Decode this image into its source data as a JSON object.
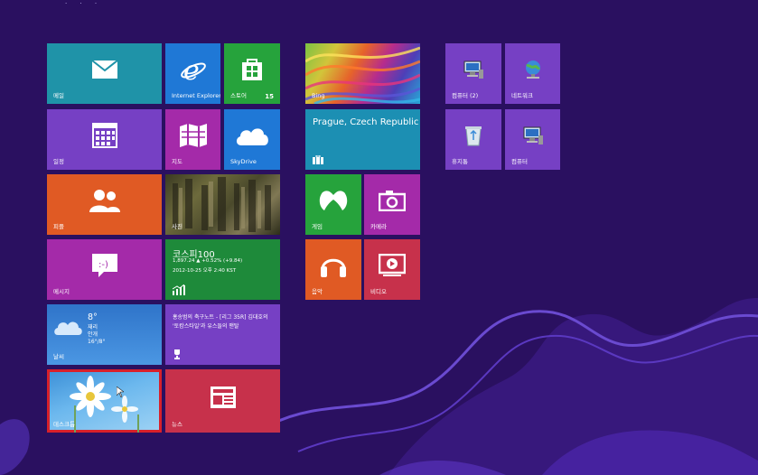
{
  "screen": {
    "background": "#2a1060",
    "top_dots": "· · ·"
  },
  "tiles": {
    "mail": {
      "label": "메일",
      "icon": "mail-icon",
      "color": "#1f93a8"
    },
    "ie": {
      "label": "Internet Explorer",
      "icon": "ie-icon",
      "color": "#1f78d6"
    },
    "store": {
      "label": "스토어",
      "badge": "15",
      "icon": "store-icon",
      "color": "#26a33c"
    },
    "calendar": {
      "label": "일정",
      "icon": "calendar-icon",
      "color": "#7640c4"
    },
    "maps": {
      "label": "지도",
      "icon": "map-icon",
      "color": "#a42aa9"
    },
    "skydrive": {
      "label": "SkyDrive",
      "icon": "cloud-icon",
      "color": "#1f78d6"
    },
    "people": {
      "label": "피플",
      "icon": "people-icon",
      "color": "#e05a24"
    },
    "photos": {
      "label": "사진",
      "icon": "photo"
    },
    "messaging": {
      "label": "메시지",
      "icon": "chat-icon",
      "color": "#a42aa9"
    },
    "finance": {
      "title": "코스피100",
      "line1": "1,897.24  ▲ +0.52% (+9.84)",
      "line2": "2012-10-25 오후 2:40 KST",
      "icon": "chart-icon",
      "color": "#1e8a3a"
    },
    "weather": {
      "temp": "8°",
      "cond": "재리",
      "place": "안개",
      "range": "16°/8°",
      "label": "날씨",
      "color": "#2b7fcf"
    },
    "news": {
      "text": "홍송범의 축구노트 - [리그 35R] 김대호의 '토캄스타일'과 유스들의 맨탈",
      "icon": "trophy-icon",
      "color": "#7640c4"
    },
    "desktop": {
      "label": "데스크톱",
      "selected": true
    },
    "newsapp": {
      "label": "뉴스",
      "icon": "newspaper-icon",
      "color": "#c7314b"
    },
    "bing": {
      "label": "Bing"
    },
    "travel": {
      "text": "Prague, Czech Republic",
      "icon": "suitcase-icon",
      "color": "#1c8fb3"
    },
    "games": {
      "label": "게임",
      "icon": "xbox-icon",
      "color": "#26a33c"
    },
    "camera": {
      "label": "카메라",
      "icon": "camera-icon",
      "color": "#a42aa9"
    },
    "music": {
      "label": "음악",
      "icon": "headphones-icon",
      "color": "#e05a24"
    },
    "video": {
      "label": "비디오",
      "icon": "video-icon",
      "color": "#c7314b"
    },
    "computer2": {
      "label": "컴퓨터 (2)",
      "icon": "computer-icon",
      "color": "#7640c4"
    },
    "network": {
      "label": "네트워크",
      "icon": "network-icon",
      "color": "#7640c4"
    },
    "recycle": {
      "label": "휴지통",
      "icon": "recycle-bin-icon",
      "color": "#7640c4"
    },
    "computer": {
      "label": "컴퓨터",
      "icon": "computer-icon",
      "color": "#7640c4"
    }
  }
}
